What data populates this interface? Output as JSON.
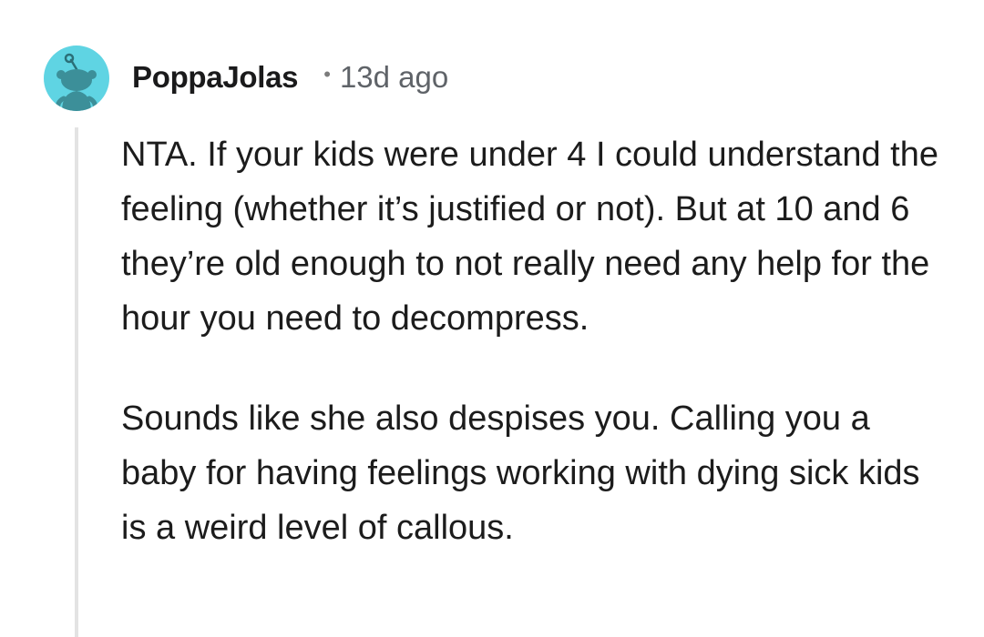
{
  "comment": {
    "username": "PoppaJolas",
    "separator": "•",
    "age": "13d ago",
    "avatar_icon": "reddit-snoo-avatar-icon",
    "avatar_color": "#5fd4e3",
    "paragraphs": [
      "NTA. If your kids were under 4 I could understand the feeling (whether it’s justified or not). But at 10 and 6 they’re old enough to not really need any help for the hour you need to decompress.",
      "Sounds like she also despises you. Calling you a baby for having feelings working with dying sick kids is a weird level of callous."
    ]
  }
}
